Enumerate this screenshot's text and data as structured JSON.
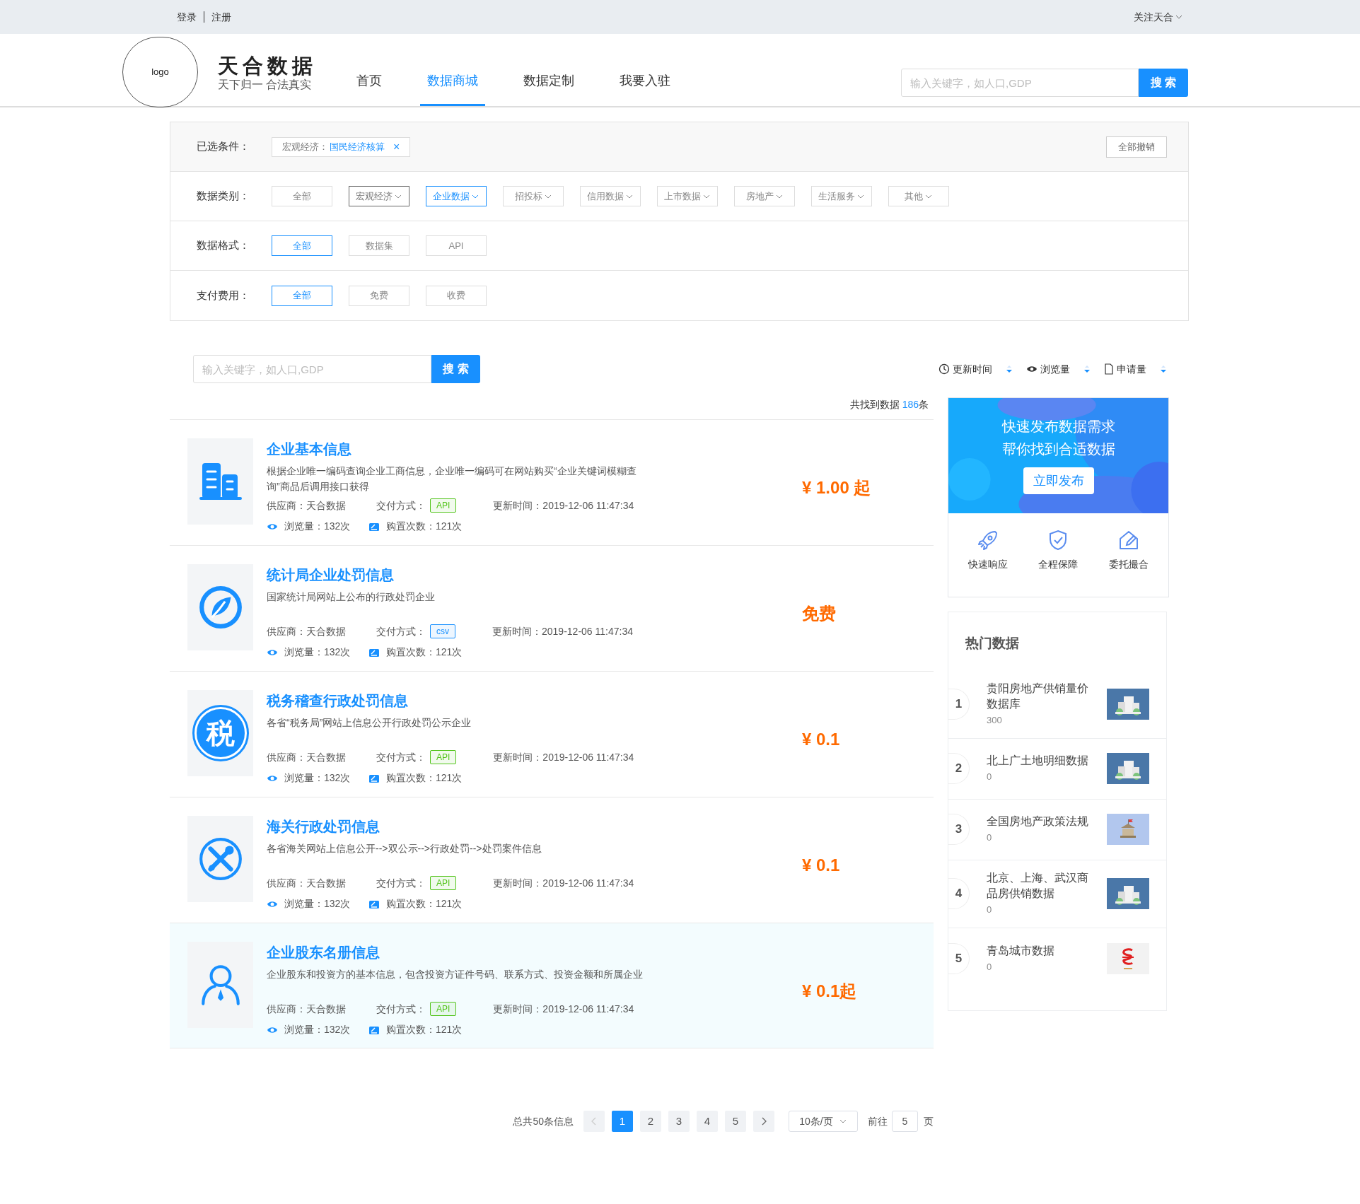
{
  "top_bar": {
    "links": [
      "登录",
      "注册"
    ],
    "follow": "关注天合"
  },
  "header": {
    "logo": "logo",
    "brand": "天合数据",
    "slogan": "天下归一 合法真实",
    "nav": [
      {
        "label": "首页",
        "selected": false
      },
      {
        "label": "数据商城",
        "selected": true
      },
      {
        "label": "数据定制",
        "selected": false
      },
      {
        "label": "我要入驻",
        "selected": false
      }
    ],
    "search": {
      "placeholder": "输入关键字，如人口,GDP",
      "button": "搜 索"
    }
  },
  "filters": {
    "selected_label": "已选条件：",
    "chip": {
      "prefix": "宏观经济：",
      "value": "国民经济核算",
      "remove": "×"
    },
    "clear": "全部撤销",
    "rows": [
      {
        "label": "数据类别：",
        "options": [
          {
            "label": "全部",
            "selected": false,
            "dropdown": false,
            "hovered": false
          },
          {
            "label": "宏观经济",
            "selected": false,
            "dropdown": true,
            "hovered": true
          },
          {
            "label": "企业数据",
            "selected": true,
            "dropdown": true,
            "hovered": false
          },
          {
            "label": "招投标",
            "selected": false,
            "dropdown": true,
            "hovered": false
          },
          {
            "label": "信用数据",
            "selected": false,
            "dropdown": true,
            "hovered": false
          },
          {
            "label": "上市数据",
            "selected": false,
            "dropdown": true,
            "hovered": false
          },
          {
            "label": "房地产",
            "selected": false,
            "dropdown": true,
            "hovered": false
          },
          {
            "label": "生活服务",
            "selected": false,
            "dropdown": true,
            "hovered": false
          },
          {
            "label": "其他",
            "selected": false,
            "dropdown": true,
            "hovered": false
          }
        ]
      },
      {
        "label": "数据格式：",
        "options": [
          {
            "label": "全部",
            "selected": true,
            "dropdown": false,
            "hovered": false
          },
          {
            "label": "数据集",
            "selected": false,
            "dropdown": false,
            "hovered": false
          },
          {
            "label": "API",
            "selected": false,
            "dropdown": false,
            "hovered": false
          }
        ]
      },
      {
        "label": "支付费用：",
        "options": [
          {
            "label": "全部",
            "selected": true,
            "dropdown": false,
            "hovered": false
          },
          {
            "label": "免费",
            "selected": false,
            "dropdown": false,
            "hovered": false
          },
          {
            "label": "收费",
            "selected": false,
            "dropdown": false,
            "hovered": false
          }
        ]
      }
    ]
  },
  "list_search": {
    "placeholder": "输入关键字，如人口,GDP",
    "button": "搜 索"
  },
  "sort": [
    {
      "kind": "clock",
      "label": "更新时间"
    },
    {
      "kind": "eye",
      "label": "浏览量"
    },
    {
      "kind": "doc",
      "label": "申请量"
    }
  ],
  "count": {
    "prefix": "共找到数据 ",
    "number": "186",
    "suffix": "条"
  },
  "items": [
    {
      "kind": "building",
      "title": "企业基本信息",
      "desc": "根据企业唯一编码查询企业工商信息，企业唯一编码可在网站购买“企业关键词模糊查询”商品后调用接口获得",
      "supplier": "供应商：天合数据",
      "delivery_label": "交付方式：",
      "delivery": "API",
      "color": "#52c41a",
      "updated": "更新时间：2019-12-06 11:47:34",
      "views": "浏览量：132次",
      "buys": "购置次数：121次",
      "price": "¥ 1.00 起",
      "highlighted": false
    },
    {
      "kind": "leaf",
      "title": "统计局企业处罚信息",
      "desc": "国家统计局网站上公布的行政处罚企业",
      "supplier": "供应商：天合数据",
      "delivery_label": "交付方式：",
      "delivery": "csv",
      "color": "#1890ff",
      "updated": "更新时间：2019-12-06 11:47:34",
      "views": "浏览量：132次",
      "buys": "购置次数：121次",
      "price": "免费",
      "highlighted": false
    },
    {
      "kind": "glyph",
      "glyph": "税",
      "title": "税务稽查行政处罚信息",
      "desc": "各省“税务局”网站上信息公开行政处罚公示企业",
      "supplier": "供应商：天合数据",
      "delivery_label": "交付方式：",
      "delivery": "API",
      "color": "#52c41a",
      "updated": "更新时间：2019-12-06 11:47:34",
      "views": "浏览量：132次",
      "buys": "购置次数：121次",
      "price": "¥ 0.1",
      "highlighted": false
    },
    {
      "kind": "tools",
      "title": "海关行政处罚信息",
      "desc": "各省海关网站上信息公开-->双公示-->行政处罚-->处罚案件信息",
      "supplier": "供应商：天合数据",
      "delivery_label": "交付方式：",
      "delivery": "API",
      "color": "#52c41a",
      "updated": "更新时间：2019-12-06 11:47:34",
      "views": "浏览量：132次",
      "buys": "购置次数：121次",
      "price": "¥ 0.1",
      "highlighted": false
    },
    {
      "kind": "person",
      "title": "企业股东名册信息",
      "desc": "企业股东和投资方的基本信息，包含投资方证件号码、联系方式、投资金额和所属企业",
      "supplier": "供应商：天合数据",
      "delivery_label": "交付方式：",
      "delivery": "API",
      "color": "#52c41a",
      "updated": "更新时间：2019-12-06 11:47:34",
      "views": "浏览量：132次",
      "buys": "购置次数：121次",
      "price": "¥ 0.1起",
      "highlighted": true
    }
  ],
  "banner": {
    "lines": [
      "快速发布数据需求",
      "帮你找到合适数据"
    ],
    "button": "立即发布",
    "features": [
      {
        "kind": "rocket",
        "label": "快速响应"
      },
      {
        "kind": "shield",
        "label": "全程保障"
      },
      {
        "kind": "edit",
        "label": "委托撮合"
      }
    ]
  },
  "hot": {
    "title": "热门数据",
    "items": [
      {
        "rank": "1",
        "name": "贵阳房地产供销量价数据库",
        "count": "300",
        "kind": "picture"
      },
      {
        "rank": "2",
        "name": "北上广土地明细数据",
        "count": "0",
        "kind": "picture"
      },
      {
        "rank": "3",
        "name": "全国房地产政策法规",
        "count": "0",
        "kind": "picture"
      },
      {
        "rank": "4",
        "name": "北京、上海、武汉商品房供销数据",
        "count": "0",
        "kind": "picture"
      },
      {
        "rank": "5",
        "name": "青岛城市数据",
        "count": "0",
        "kind": "picture"
      }
    ]
  },
  "pagination": {
    "total": "总共50条信息",
    "pages": [
      {
        "label": "1",
        "selected": true
      },
      {
        "label": "2",
        "selected": false
      },
      {
        "label": "3",
        "selected": false
      },
      {
        "label": "4",
        "selected": false
      },
      {
        "label": "5",
        "selected": false
      }
    ],
    "page_size": "10条/页",
    "goto_label": "前往",
    "goto_value": "5",
    "goto_unit": "页"
  }
}
